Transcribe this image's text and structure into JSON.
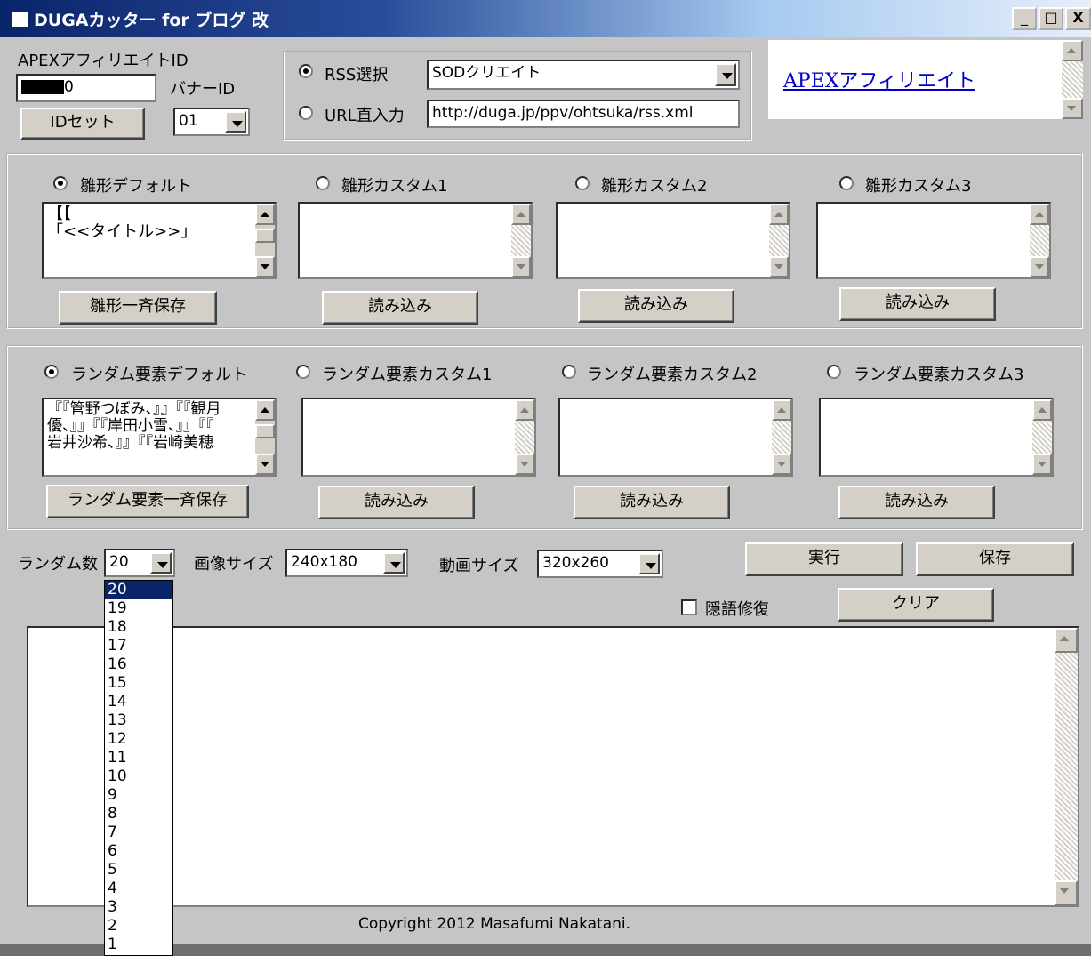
{
  "window": {
    "title": "DUGAカッター for ブログ 改",
    "minimize": "_",
    "maximize": "□",
    "close": "X"
  },
  "apex": {
    "label": "APEXアフィリエイトID",
    "id_value": "0",
    "id_set_button": "IDセット"
  },
  "banner": {
    "label": "バナーID",
    "value": "01"
  },
  "rss": {
    "radio_label": "RSS選択",
    "selected": "SODクリエイト",
    "url_label": "URL直入力",
    "url_value": "http://duga.jp/ppv/ohtsuka/rss.xml"
  },
  "link": {
    "text": "APEXアフィリエイト"
  },
  "template_section": {
    "radios": [
      "雛形デフォルト",
      "雛形カスタム1",
      "雛形カスタム2",
      "雛形カスタム3"
    ],
    "default_text": "【【\n「<<タイトル>>」",
    "save_all_button": "雛形一斉保存",
    "load_button": "読み込み"
  },
  "random_section": {
    "radios": [
      "ランダム要素デフォルト",
      "ランダム要素カスタム1",
      "ランダム要素カスタム2",
      "ランダム要素カスタム3"
    ],
    "default_text": "『『管野つぼみ、』』『『観月\n優、』』『『岸田小雪、』』『『\n岩井沙希、』』『『岩崎美穂",
    "save_all_button": "ランダム要素一斉保存",
    "load_button": "読み込み"
  },
  "options": {
    "random_count_label": "ランダム数",
    "random_count_value": "20",
    "image_size_label": "画像サイズ",
    "image_size_value": "240x180",
    "video_size_label": "動画サイズ",
    "video_size_value": "320x260",
    "run_button": "実行",
    "save_button": "保存",
    "hidden_word_label": "隠語修復",
    "clear_button": "クリア"
  },
  "dropdown": {
    "options": [
      "20",
      "19",
      "18",
      "17",
      "16",
      "15",
      "14",
      "13",
      "12",
      "11",
      "10",
      "9",
      "8",
      "7",
      "6",
      "5",
      "4",
      "3",
      "2",
      "1"
    ],
    "selected": "20"
  },
  "footer": {
    "copyright": "Copyright 2012 Masafumi Nakatani."
  },
  "colors": {
    "title_start": "#0a246a",
    "selection": "#0a246a",
    "face": "#c5c5c5",
    "link": "#0000cc"
  }
}
